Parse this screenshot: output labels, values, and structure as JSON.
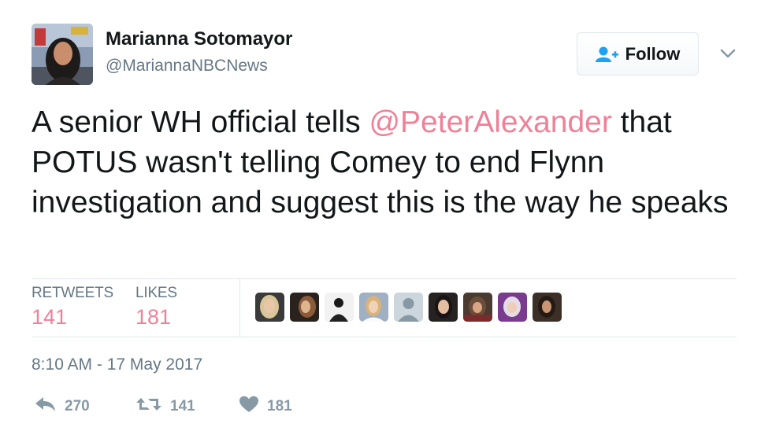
{
  "author": {
    "name": "Marianna Sotomayor",
    "handle": "@MariannaNBCNews"
  },
  "follow_button": {
    "label": "Follow",
    "icon": "add-user-icon"
  },
  "tweet": {
    "text_before_mention": "A senior WH official tells ",
    "mention": "@PeterAlexander",
    "text_after_mention": " that POTUS wasn't telling Comey to end Flynn investigation and suggest this is the way he speaks"
  },
  "stats": {
    "retweets_label": "RETWEETS",
    "retweets_value": "141",
    "likes_label": "LIKES",
    "likes_value": "181"
  },
  "likers_count": 9,
  "timestamp": "8:10 AM - 17 May 2017",
  "actions": {
    "reply_count": "270",
    "retweet_count": "141",
    "like_count": "181"
  },
  "colors": {
    "accent_pink": "#f08098",
    "muted": "#657786",
    "action_gray": "#8899a6",
    "follow_icon": "#1da1f2",
    "border": "#e1e8ed"
  }
}
